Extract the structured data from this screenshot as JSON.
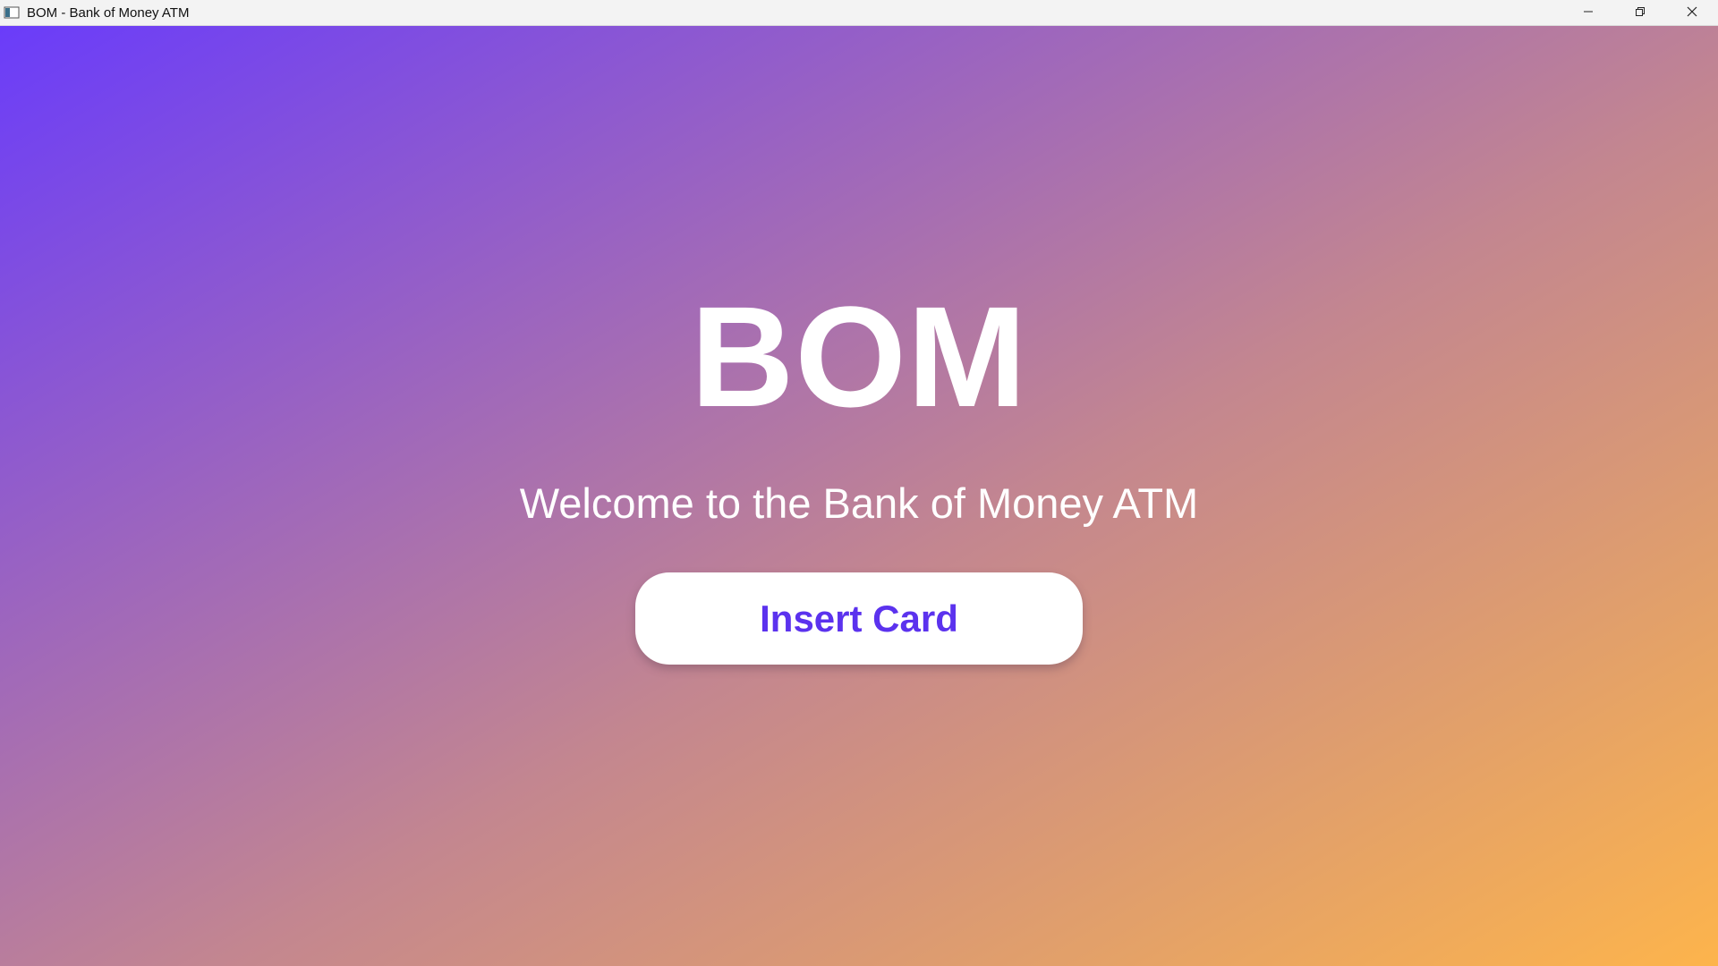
{
  "window": {
    "title": "BOM - Bank of Money ATM",
    "app_icon": "window-app-icon",
    "controls": {
      "minimize_icon": "minimize-icon",
      "restore_icon": "restore-icon",
      "close_icon": "close-icon"
    }
  },
  "main": {
    "logo_text": "BOM",
    "welcome_text": "Welcome to the Bank of Money ATM",
    "insert_card_label": "Insert Card"
  },
  "colors": {
    "gradient_start": "#6a3cfa",
    "gradient_end": "#fdb44c",
    "button_text": "#5b32ee",
    "button_bg": "#ffffff",
    "text": "#ffffff"
  }
}
